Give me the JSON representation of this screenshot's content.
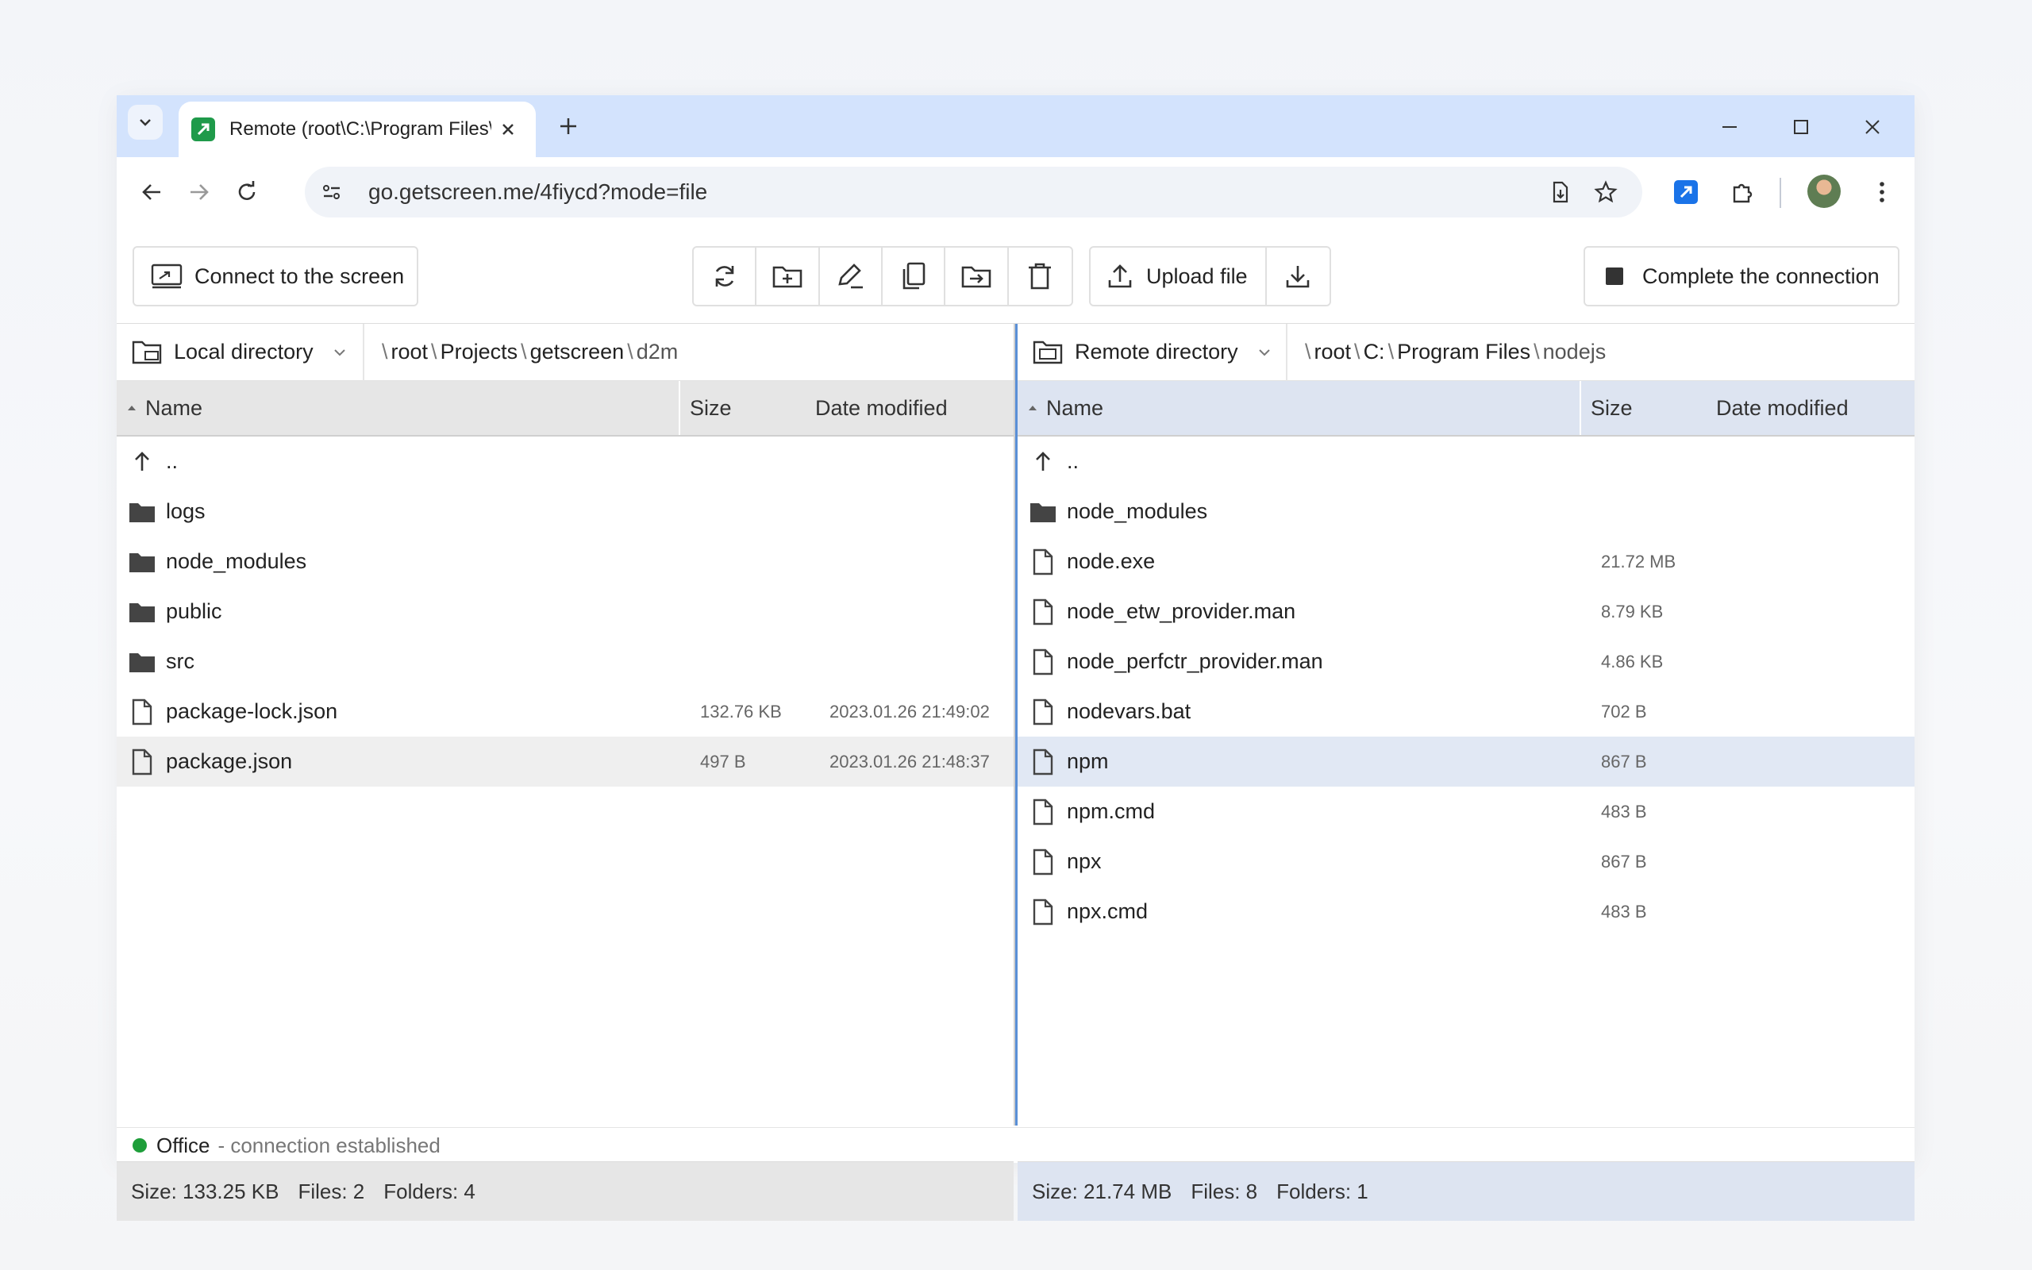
{
  "browser": {
    "tab_title": "Remote (root\\C:\\Program Files\\",
    "url": "go.getscreen.me/4fiycd?mode=file"
  },
  "toolbar": {
    "connect_label": "Connect to the screen",
    "upload_label": "Upload file",
    "complete_label": "Complete the connection"
  },
  "left": {
    "dir_label": "Local directory",
    "path": [
      "root",
      "Projects",
      "getscreen",
      "d2m"
    ],
    "columns": {
      "name": "Name",
      "size": "Size",
      "date": "Date modified"
    },
    "rows": [
      {
        "type": "up",
        "name": "..",
        "size": "",
        "date": ""
      },
      {
        "type": "folder",
        "name": "logs",
        "size": "",
        "date": ""
      },
      {
        "type": "folder",
        "name": "node_modules",
        "size": "",
        "date": ""
      },
      {
        "type": "folder",
        "name": "public",
        "size": "",
        "date": ""
      },
      {
        "type": "folder",
        "name": "src",
        "size": "",
        "date": ""
      },
      {
        "type": "file",
        "name": "package-lock.json",
        "size": "132.76 KB",
        "date": "2023.01.26 21:49:02"
      },
      {
        "type": "file",
        "name": "package.json",
        "size": "497 B",
        "date": "2023.01.26 21:48:37"
      }
    ],
    "footer": {
      "size": "Size: 133.25 KB",
      "files": "Files: 2",
      "folders": "Folders: 4"
    }
  },
  "right": {
    "dir_label": "Remote directory",
    "path": [
      "root",
      "C:",
      "Program Files",
      "nodejs"
    ],
    "columns": {
      "name": "Name",
      "size": "Size",
      "date": "Date modified"
    },
    "rows": [
      {
        "type": "up",
        "name": "..",
        "size": "",
        "date": ""
      },
      {
        "type": "folder",
        "name": "node_modules",
        "size": "",
        "date": ""
      },
      {
        "type": "file",
        "name": "node.exe",
        "size": "21.72 MB",
        "date": ""
      },
      {
        "type": "file",
        "name": "node_etw_provider.man",
        "size": "8.79 KB",
        "date": ""
      },
      {
        "type": "file",
        "name": "node_perfctr_provider.man",
        "size": "4.86 KB",
        "date": ""
      },
      {
        "type": "file",
        "name": "nodevars.bat",
        "size": "702 B",
        "date": ""
      },
      {
        "type": "file",
        "name": "npm",
        "size": "867 B",
        "date": ""
      },
      {
        "type": "file",
        "name": "npm.cmd",
        "size": "483 B",
        "date": ""
      },
      {
        "type": "file",
        "name": "npx",
        "size": "867 B",
        "date": ""
      },
      {
        "type": "file",
        "name": "npx.cmd",
        "size": "483 B",
        "date": ""
      }
    ],
    "footer": {
      "size": "Size: 21.74 MB",
      "files": "Files: 8",
      "folders": "Folders: 1"
    }
  },
  "status": {
    "name": "Office",
    "text": "- connection established"
  },
  "colors": {
    "accent": "#1a73e8",
    "tabbar": "#d3e3fd",
    "status_ok": "#1e9e3a"
  }
}
